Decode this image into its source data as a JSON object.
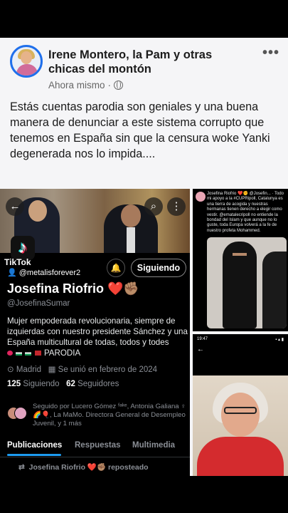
{
  "post": {
    "page_name": "Irene Montero, la Pam y otras chicas del montón",
    "timestamp": "Ahora mismo",
    "separator": "·",
    "text": "Estás cuentas parodia son geniales y una buena manera de denunciar a este sistema corrupto que tenemos en España sin que la censura woke Yanki degenerada nos lo impida...."
  },
  "profile_shot": {
    "tiktok_label": "TikTok",
    "tiktok_user": "@metalisforever2",
    "follow_label": "Siguiendo",
    "name": "Josefina Riofrio ❤️✊🏽",
    "handle": "@JosefinaSumar",
    "bio": "Mujer empoderada revolucionaria, siempre de izquierdas con nuestro presidente Sánchez y una España multicultural de todas, todos y todes",
    "bio_tag": "PARODIA",
    "location": "Madrid",
    "joined": "Se unió en febrero de 2024",
    "following_count": "125",
    "following_label": "Siguiendo",
    "followers_count": "62",
    "followers_label": "Seguidores",
    "followed_by": "Seguido por Lucero Gómez ᶠᵃᵏᵉ, Antonia Galiana ♀🌈🎈, La MaMo. Directora General de Desempleo Juvenil, y 1 más",
    "tabs": [
      "Publicaciones",
      "Respuestas",
      "Multimedia"
    ],
    "repost_text": "Josefina Riofrio ❤️✊🏽 reposteado"
  },
  "tweet_shot": {
    "text": "Josefina Riofrio ❤️✊ @Josefin... · Todo mi apoyo a la #CUPRipoll, Catalunya es una tierra de acogida y nuestras hermanas tienen derecho a elegir como vestir. @ematalecripoll no entiende la bondad del Islam y que aunque no lo guste, toda Europa volverá a la fe de nuestro profeta Mohammed."
  },
  "photo_shot": {
    "time": "19:47",
    "status_icons": "▪ ▴ ▮"
  },
  "colors": {
    "accent_blue": "#1d9bf0",
    "flag_palestine": "#149954",
    "flag_morocco": "#c1272d"
  }
}
